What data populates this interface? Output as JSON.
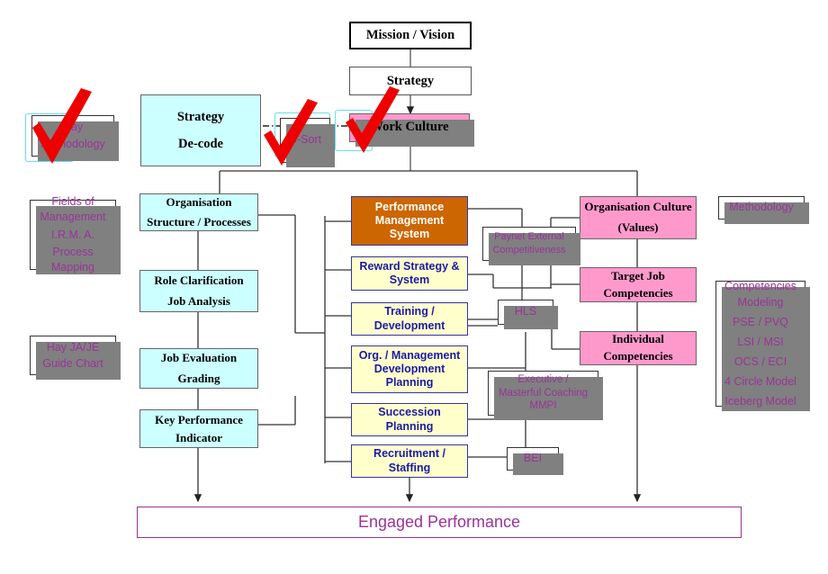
{
  "diagram": {
    "title_top": "Mission / Vision",
    "strategy": "Strategy",
    "work_culture": "Work Culture",
    "engaged_performance": "Engaged Performance",
    "c_sort": "C-Sort"
  },
  "strategy_decode": {
    "line1": "Strategy",
    "line2": "De-code"
  },
  "left_column": [
    {
      "name": "organisation-structure",
      "lines": [
        "Organisation",
        "Structure / Processes"
      ]
    },
    {
      "name": "role-clarification",
      "lines": [
        "Role Clarification",
        "Job Analysis"
      ]
    },
    {
      "name": "job-evaluation",
      "lines": [
        "Job Evaluation",
        "Grading"
      ]
    },
    {
      "name": "key-performance-indicator",
      "lines": [
        "Key Performance",
        "Indicator"
      ]
    }
  ],
  "center_column": [
    {
      "name": "performance-management-system",
      "lines": [
        "Performance",
        "Management",
        "System"
      ]
    },
    {
      "name": "reward-strategy-system",
      "lines": [
        "Reward Strategy &",
        "System"
      ]
    },
    {
      "name": "training-development",
      "lines": [
        "Training /",
        "Development"
      ]
    },
    {
      "name": "org-management-development-planning",
      "lines": [
        "Org. / Management",
        "Development",
        "Planning"
      ]
    },
    {
      "name": "succession-planning",
      "lines": [
        "Succession",
        "Planning"
      ]
    },
    {
      "name": "recruitment-staffing",
      "lines": [
        "Recruitment /",
        "Staffing"
      ]
    }
  ],
  "right_column": [
    {
      "name": "organisation-culture",
      "lines": [
        "Organisation Culture",
        "(Values)"
      ]
    },
    {
      "name": "target-job-competencies",
      "lines": [
        "Target Job",
        "Competencies"
      ]
    },
    {
      "name": "individual-competencies",
      "lines": [
        "Individual",
        "Competencies"
      ]
    }
  ],
  "tool_notes": [
    {
      "name": "paynet-external-competitiveness",
      "lines": [
        "Paynet External",
        "Competitiveness"
      ]
    },
    {
      "name": "hls",
      "lines": [
        "HLS"
      ]
    },
    {
      "name": "executive-masterful-coaching",
      "lines": [
        "Executive /",
        "Masterful Coaching",
        "MMPI"
      ]
    },
    {
      "name": "bei",
      "lines": [
        "BEI"
      ]
    }
  ],
  "left_notes": [
    {
      "name": "hay-methodology",
      "lines": [
        "Hay",
        "Methodology"
      ]
    },
    {
      "name": "fields-of-management",
      "lines": [
        "Fields  of",
        "Management",
        "I.R.M. A.",
        "Process",
        "Mapping"
      ]
    },
    {
      "name": "hay-ja-je",
      "lines": [
        "Hay JA/JE",
        "Guide Chart"
      ]
    }
  ],
  "right_notes": [
    {
      "name": "methodology",
      "lines": [
        "Methodology"
      ]
    },
    {
      "name": "competencies-modeling",
      "lines": [
        "Competencies",
        "Modeling",
        "PSE / PVQ",
        "LSI / MSI",
        "OCS / ECI",
        "4 Circle Model",
        "Iceberg Model"
      ]
    }
  ],
  "colors": {
    "cyan": "#ccffff",
    "pink": "#ff99cc",
    "yellow": "#ffffcc",
    "orange": "#cc6600",
    "purple_text": "#993399",
    "blue_text": "#1a1aa8",
    "tick_red": "#ee0000",
    "shadow": "#808080"
  }
}
